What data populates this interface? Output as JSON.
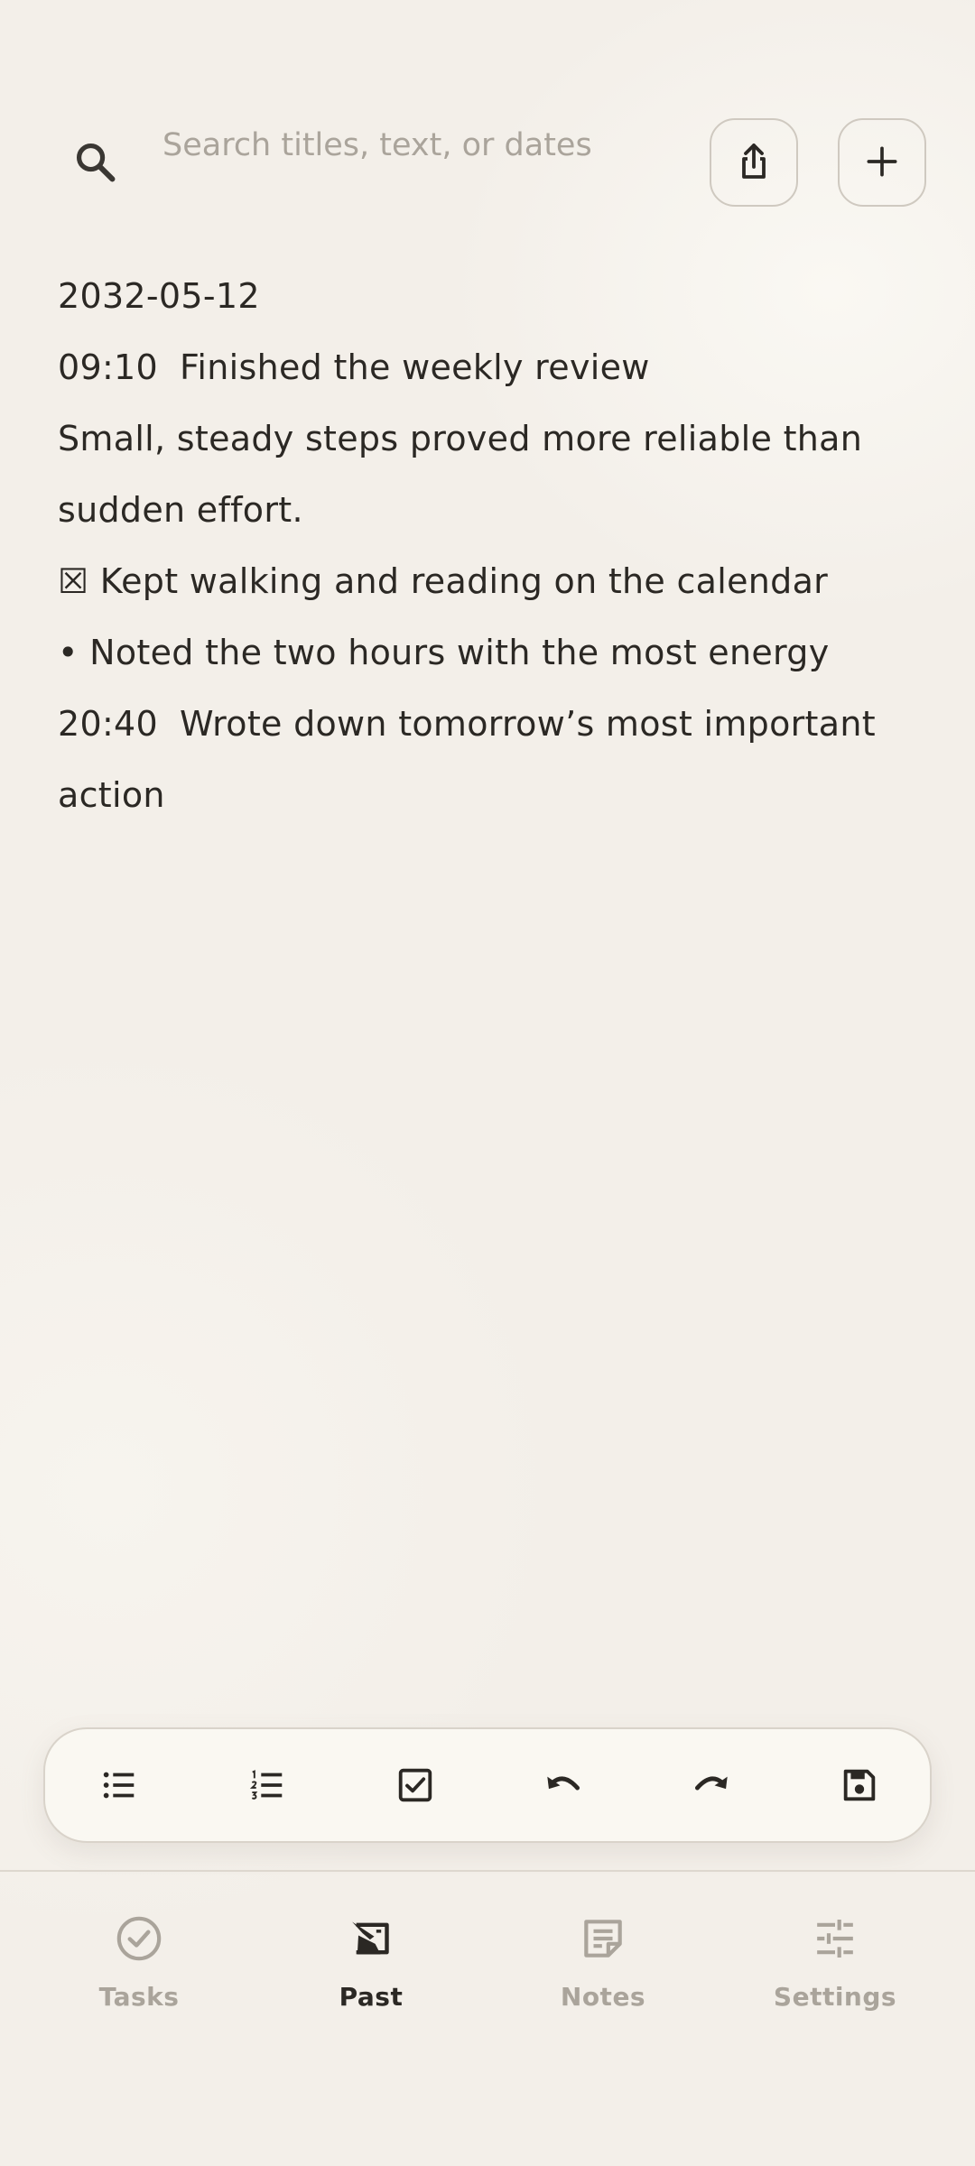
{
  "header": {
    "search_placeholder": "Search titles, text, or dates",
    "search_value": ""
  },
  "note": {
    "date": "2032-05-12",
    "entries": [
      {
        "time": "09:10",
        "text": "Finished the weekly review"
      },
      {
        "body": "Small, steady steps proved more reliable than sudden effort."
      },
      {
        "mark": "☒",
        "text": "Kept walking and reading on the calendar"
      },
      {
        "mark": "•",
        "text": "Noted the two hours with the most energy"
      },
      {
        "time": "20:40",
        "text": "Wrote down tomorrow’s most important action"
      }
    ]
  },
  "toolbar": {
    "icons": [
      "bulleted-list-icon",
      "numbered-list-icon",
      "checkbox-icon",
      "undo-icon",
      "redo-icon",
      "save-icon"
    ]
  },
  "nav": {
    "items": [
      {
        "label": "Tasks",
        "icon": "check-circle-icon",
        "active": false
      },
      {
        "label": "Past",
        "icon": "history-book-icon",
        "active": true
      },
      {
        "label": "Notes",
        "icon": "note-icon",
        "active": false
      },
      {
        "label": "Settings",
        "icon": "sliders-icon",
        "active": false
      }
    ]
  },
  "colors": {
    "background": "#f3efe9",
    "text": "#2b2824",
    "muted": "#aaa49b",
    "toolbar_bg": "#faf8f2",
    "border": "#cfc9c0"
  }
}
